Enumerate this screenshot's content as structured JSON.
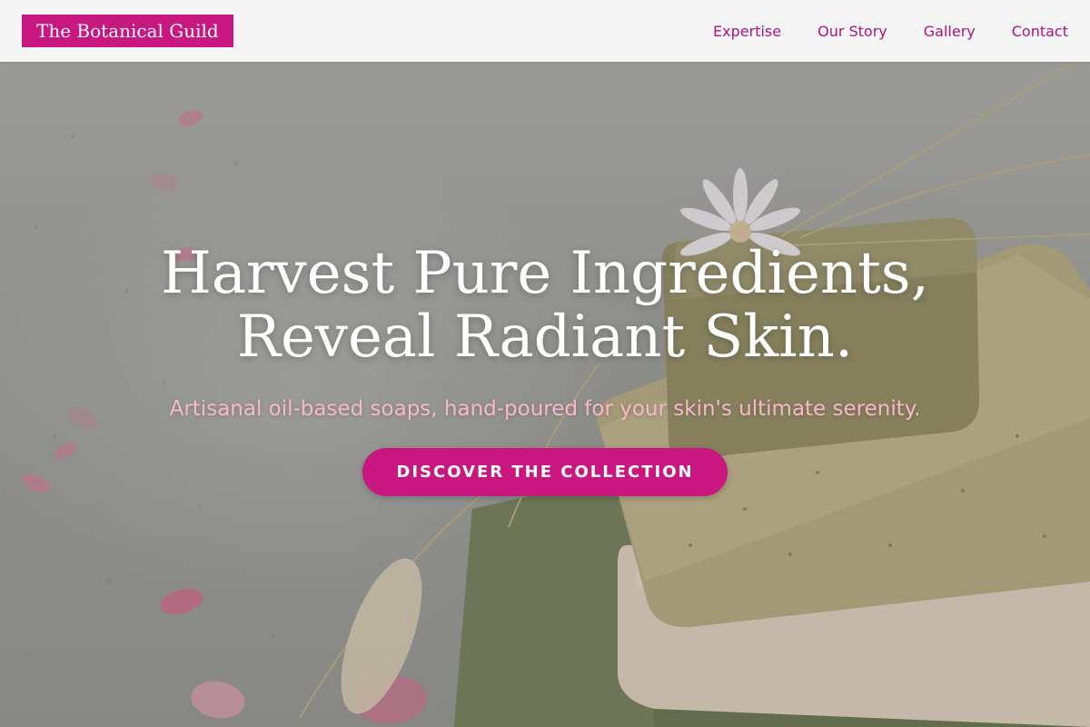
{
  "header": {
    "logo_text": "The Botanical Guild",
    "nav": [
      {
        "label": "Expertise"
      },
      {
        "label": "Our Story"
      },
      {
        "label": "Gallery"
      },
      {
        "label": "Contact"
      }
    ]
  },
  "hero": {
    "title_line1": "Harvest Pure Ingredients,",
    "title_line2": "Reveal Radiant Skin.",
    "subtitle": "Artisanal oil-based soaps, hand-poured for your skin's ultimate serenity.",
    "cta_label": "DISCOVER THE COLLECTION",
    "background_image": "stacked handmade soap bars on green linen with dried flowers and rose petals"
  },
  "colors": {
    "accent": "#c8177f",
    "nav_text": "#b3127a",
    "subtitle_text": "#f7b8cc",
    "header_bg": "#f7f7f7"
  }
}
